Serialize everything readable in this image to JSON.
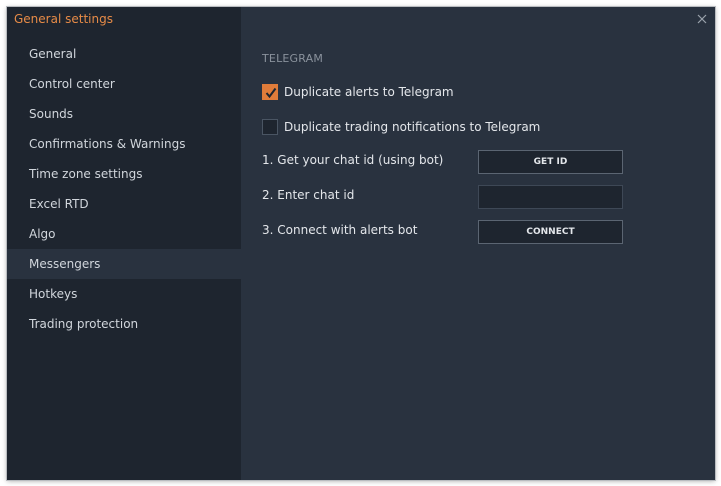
{
  "window": {
    "title": "General settings"
  },
  "sidebar": {
    "items": [
      {
        "label": "General"
      },
      {
        "label": "Control center"
      },
      {
        "label": "Sounds"
      },
      {
        "label": "Confirmations & Warnings"
      },
      {
        "label": "Time zone settings"
      },
      {
        "label": "Excel RTD"
      },
      {
        "label": "Algo"
      },
      {
        "label": "Messengers",
        "active": true
      },
      {
        "label": "Hotkeys"
      },
      {
        "label": "Trading protection"
      }
    ]
  },
  "icons": {
    "close": "close-icon",
    "check": "checkmark-icon"
  },
  "colors": {
    "accent": "#e07c3a",
    "title": "#e78b47",
    "sidebar_bg": "#1e252f",
    "content_bg": "#29323f"
  },
  "telegram": {
    "heading": "TELEGRAM",
    "duplicate_alerts": {
      "label": "Duplicate alerts to Telegram",
      "checked": true
    },
    "duplicate_notifications": {
      "label": "Duplicate trading notifications to Telegram",
      "checked": false
    },
    "step1": {
      "label": "1. Get your chat id (using bot)",
      "button": "GET ID"
    },
    "step2": {
      "label": "2. Enter chat id",
      "value": ""
    },
    "step3": {
      "label": "3. Connect with alerts bot",
      "button": "CONNECT"
    }
  }
}
